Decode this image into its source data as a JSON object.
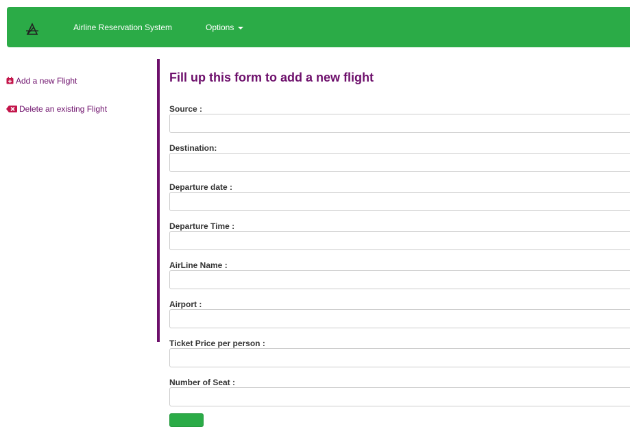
{
  "navbar": {
    "brand_title": "Airline Reservation System",
    "options_label": "Options",
    "logo_icon": "paper-plane-logo-icon",
    "background_color": "#2bab47"
  },
  "sidebar": {
    "items": [
      {
        "label": "Add a new Flight",
        "icon": "calendar-plus-icon"
      },
      {
        "label": "Delete an existing Flight",
        "icon": "backspace-x-icon"
      }
    ],
    "link_color": "#6d0f6b"
  },
  "form": {
    "title": "Fill up this form to add a new flight",
    "fields": [
      {
        "label": "Source :",
        "value": ""
      },
      {
        "label": "Destination:",
        "value": ""
      },
      {
        "label": "Departure date :",
        "value": ""
      },
      {
        "label": "Departure Time :",
        "value": ""
      },
      {
        "label": "AirLine Name :",
        "value": ""
      },
      {
        "label": "Airport :",
        "value": ""
      },
      {
        "label": "Ticket Price per person :",
        "value": ""
      },
      {
        "label": "Number of Seat :",
        "value": ""
      }
    ],
    "accent_color": "#6d0f6b"
  }
}
